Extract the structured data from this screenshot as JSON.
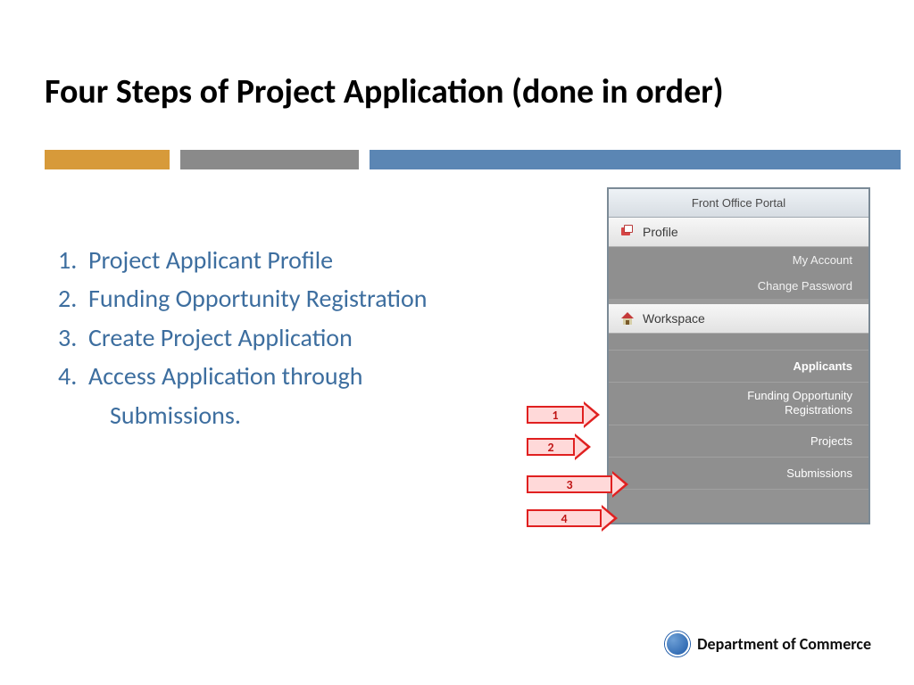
{
  "title": "Four Steps of Project Application (done in order)",
  "steps": [
    "Project Applicant Profile",
    "Funding Opportunity Registration",
    "Create Project Application",
    "Access Application through"
  ],
  "steps_cont": "Submissions.",
  "portal": {
    "header": "Front Office Portal",
    "profile": "Profile",
    "my_account": "My Account",
    "change_password": "Change Password",
    "workspace": "Workspace",
    "applicants": "Applicants",
    "funding": "Funding Opportunity\nRegistrations",
    "projects": "Projects",
    "submissions": "Submissions"
  },
  "arrows": [
    "1",
    "2",
    "3",
    "4"
  ],
  "footer": "Department of Commerce"
}
